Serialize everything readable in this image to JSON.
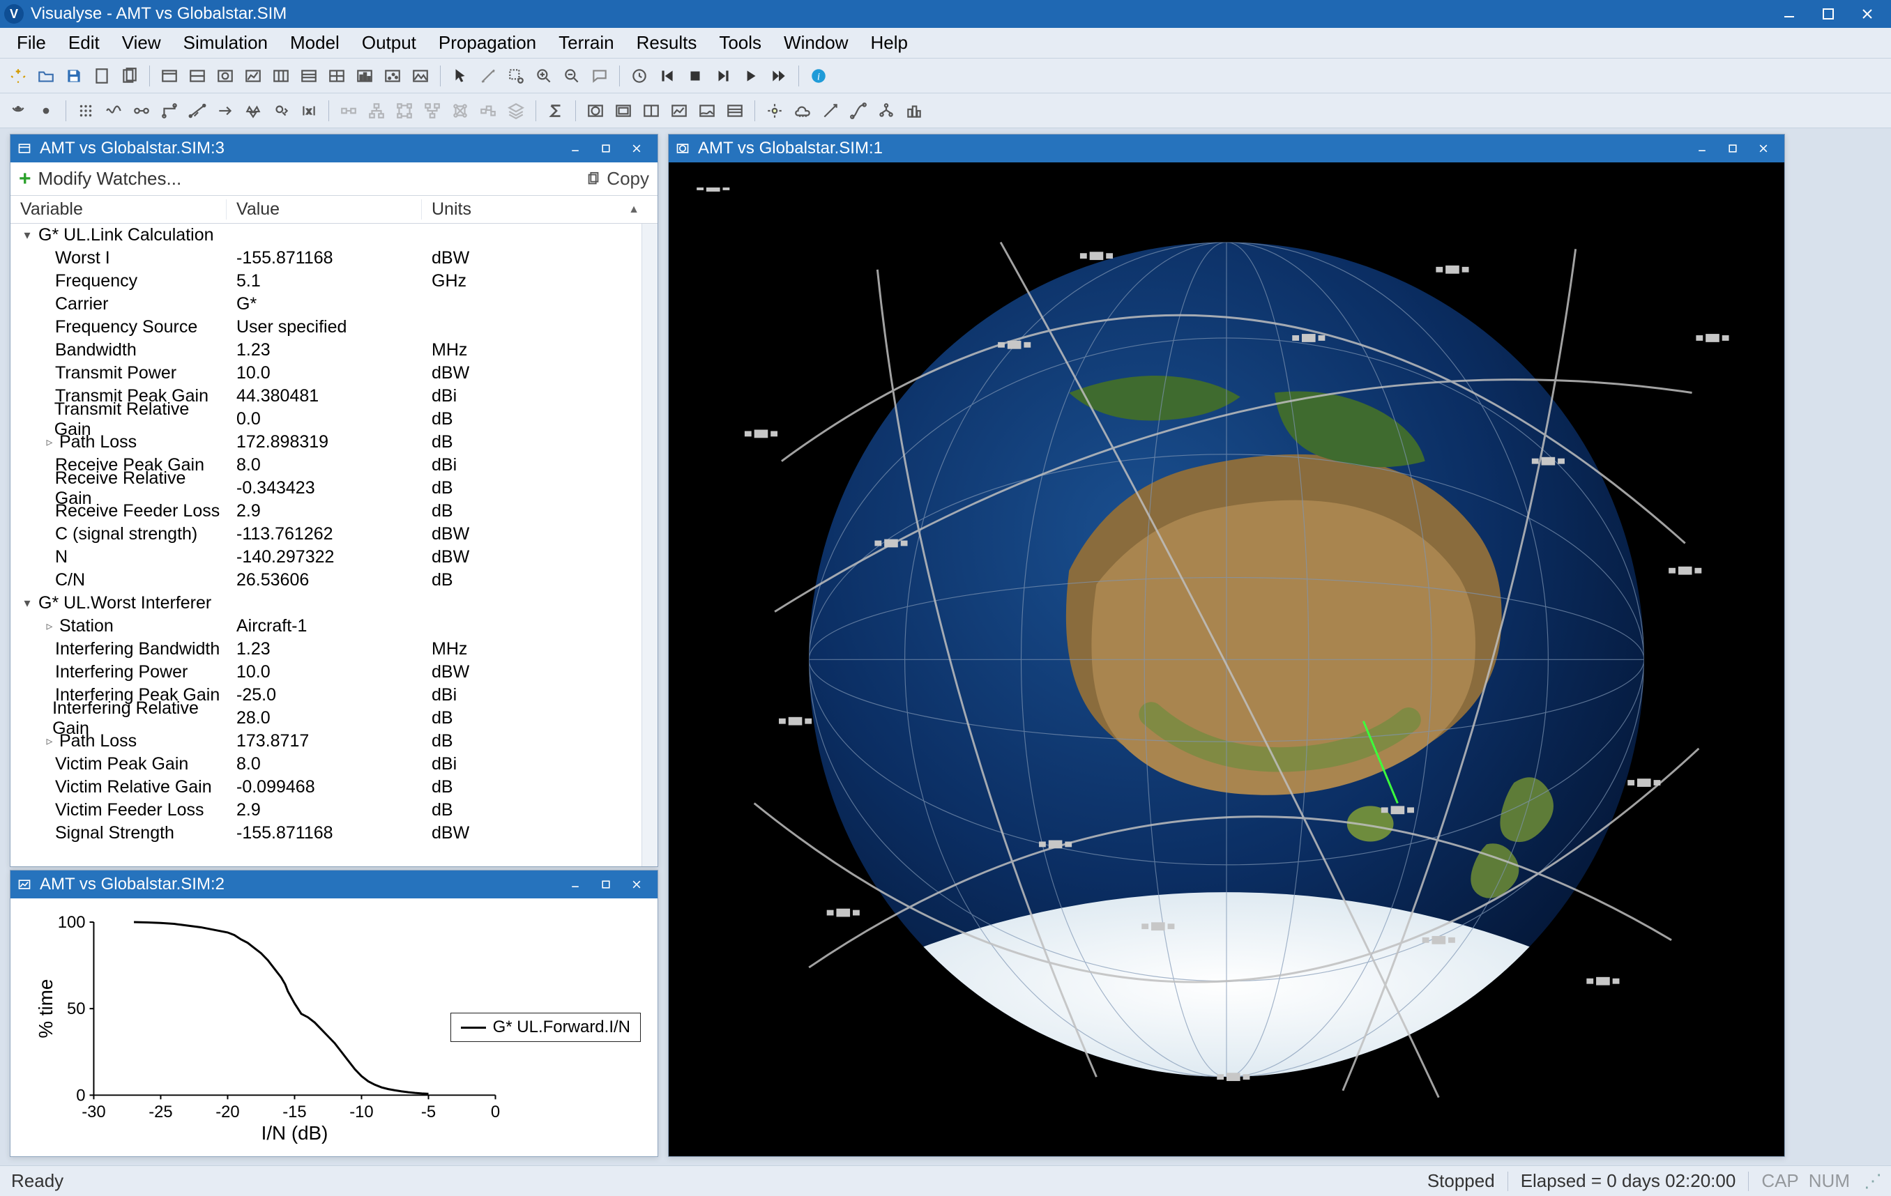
{
  "app": {
    "title": "Visualyse - AMT vs Globalstar.SIM",
    "logo_letter": "V"
  },
  "menu": [
    "File",
    "Edit",
    "View",
    "Simulation",
    "Model",
    "Output",
    "Propagation",
    "Terrain",
    "Results",
    "Tools",
    "Window",
    "Help"
  ],
  "status": {
    "left": "Ready",
    "state": "Stopped",
    "elapsed": "Elapsed = 0 days 02:20:00",
    "caps": "CAP",
    "num": "NUM"
  },
  "win1": {
    "title": "AMT vs Globalstar.SIM:1"
  },
  "win2": {
    "title": "AMT vs Globalstar.SIM:2",
    "legend": "G* UL.Forward.I/N",
    "ylabel": "% time",
    "xlabel": "I/N (dB)"
  },
  "win3": {
    "title": "AMT vs Globalstar.SIM:3",
    "modify": "Modify Watches...",
    "copy": "Copy",
    "headers": {
      "variable": "Variable",
      "value": "Value",
      "units": "Units"
    },
    "groups": [
      {
        "name": "G* UL.Link Calculation",
        "expanded": true,
        "rows": [
          {
            "var": "Worst I",
            "sub": false,
            "val": "-155.871168",
            "unit": "dBW"
          },
          {
            "var": "Frequency",
            "sub": false,
            "val": "5.1",
            "unit": "GHz"
          },
          {
            "var": "Carrier",
            "sub": false,
            "val": "G*",
            "unit": ""
          },
          {
            "var": "Frequency Source",
            "sub": false,
            "val": "User specified",
            "unit": ""
          },
          {
            "var": "Bandwidth",
            "sub": false,
            "val": "1.23",
            "unit": "MHz"
          },
          {
            "var": "Transmit Power",
            "sub": false,
            "val": "10.0",
            "unit": "dBW"
          },
          {
            "var": "Transmit Peak Gain",
            "sub": false,
            "val": "44.380481",
            "unit": "dBi"
          },
          {
            "var": "Transmit Relative Gain",
            "sub": false,
            "val": "0.0",
            "unit": "dB"
          },
          {
            "var": "Path Loss",
            "sub": true,
            "val": "172.898319",
            "unit": "dB"
          },
          {
            "var": "Receive Peak Gain",
            "sub": false,
            "val": "8.0",
            "unit": "dBi"
          },
          {
            "var": "Receive Relative Gain",
            "sub": false,
            "val": "-0.343423",
            "unit": "dB"
          },
          {
            "var": "Receive Feeder Loss",
            "sub": false,
            "val": "2.9",
            "unit": "dB"
          },
          {
            "var": "C (signal strength)",
            "sub": false,
            "val": "-113.761262",
            "unit": "dBW"
          },
          {
            "var": "N",
            "sub": false,
            "val": "-140.297322",
            "unit": "dBW"
          },
          {
            "var": "C/N",
            "sub": false,
            "val": "26.53606",
            "unit": "dB"
          }
        ]
      },
      {
        "name": "G* UL.Worst Interferer",
        "expanded": true,
        "rows": [
          {
            "var": "Station",
            "sub": true,
            "val": "Aircraft-1",
            "unit": ""
          },
          {
            "var": "Interfering Bandwidth",
            "sub": false,
            "val": "1.23",
            "unit": "MHz"
          },
          {
            "var": "Interfering Power",
            "sub": false,
            "val": "10.0",
            "unit": "dBW"
          },
          {
            "var": "Interfering Peak Gain",
            "sub": false,
            "val": "-25.0",
            "unit": "dBi"
          },
          {
            "var": "Interfering Relative Gain",
            "sub": false,
            "val": "28.0",
            "unit": "dB"
          },
          {
            "var": "Path Loss",
            "sub": true,
            "val": "173.8717",
            "unit": "dB"
          },
          {
            "var": "Victim Peak Gain",
            "sub": false,
            "val": "8.0",
            "unit": "dBi"
          },
          {
            "var": "Victim Relative Gain",
            "sub": false,
            "val": "-0.099468",
            "unit": "dB"
          },
          {
            "var": "Victim Feeder Loss",
            "sub": false,
            "val": "2.9",
            "unit": "dB"
          },
          {
            "var": "Signal Strength",
            "sub": false,
            "val": "-155.871168",
            "unit": "dBW"
          }
        ]
      }
    ]
  },
  "chart_data": {
    "type": "line",
    "title": "",
    "xlabel": "I/N (dB)",
    "ylabel": "% time",
    "xlim": [
      -30,
      0
    ],
    "ylim": [
      0,
      100
    ],
    "xticks": [
      -30,
      -25,
      -20,
      -15,
      -10,
      -5,
      0
    ],
    "yticks": [
      0,
      50,
      100
    ],
    "series": [
      {
        "name": "G* UL.Forward.I/N",
        "x": [
          -27,
          -26,
          -25,
          -24,
          -23.5,
          -23,
          -22,
          -21,
          -20,
          -19.5,
          -19,
          -18.5,
          -18,
          -17.5,
          -17,
          -16.5,
          -16,
          -15.7,
          -15.5,
          -15,
          -14.5,
          -14,
          -13.5,
          -13,
          -12.5,
          -12,
          -11.5,
          -11,
          -10.5,
          -10,
          -9.5,
          -9,
          -8.5,
          -8,
          -7.5,
          -7,
          -6.5,
          -6,
          -5.5,
          -5
        ],
        "y": [
          100,
          99.8,
          99.5,
          99,
          98.5,
          98,
          97,
          95.5,
          94,
          92.5,
          90,
          88,
          85,
          82,
          78,
          73,
          68,
          64,
          60,
          53,
          47,
          45,
          42,
          38,
          34,
          30,
          25,
          20,
          15,
          11,
          8,
          6,
          4.5,
          3.5,
          2.8,
          2.2,
          1.7,
          1.3,
          1.0,
          0.8
        ]
      }
    ]
  }
}
